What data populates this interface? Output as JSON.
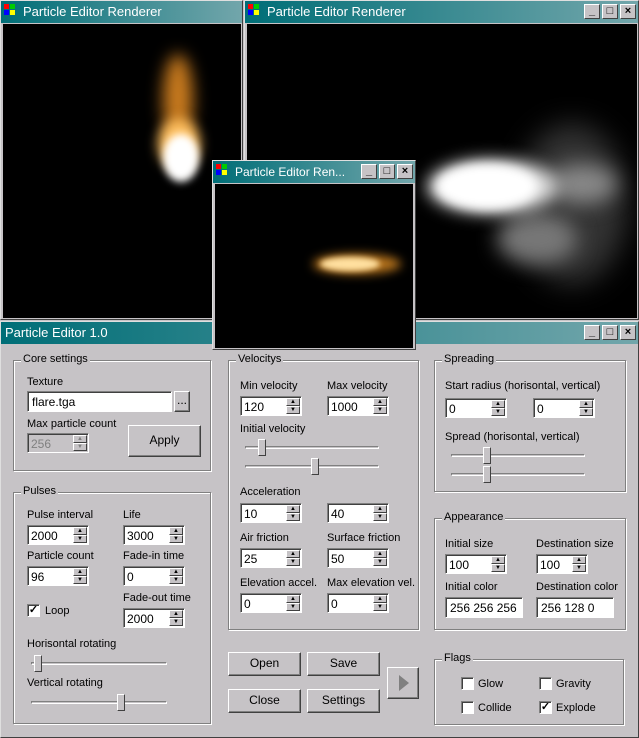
{
  "renderer": {
    "title": "Particle Editor Renderer",
    "title_small": "Particle Editor Ren..."
  },
  "editor": {
    "title": "Particle Editor 1.0"
  },
  "core": {
    "legend": "Core settings",
    "texture_label": "Texture",
    "texture_value": "flare.tga",
    "browse_label": "...",
    "max_count_label": "Max particle count",
    "max_count_value": "256",
    "apply_label": "Apply"
  },
  "pulses": {
    "legend": "Pulses",
    "pulse_interval_label": "Pulse interval",
    "pulse_interval_value": "2000",
    "life_label": "Life",
    "life_value": "3000",
    "particle_count_label": "Particle count",
    "particle_count_value": "96",
    "fade_in_label": "Fade-in time",
    "fade_in_value": "0",
    "fade_out_label": "Fade-out time",
    "fade_out_value": "2000",
    "loop_label": "Loop",
    "loop_checked": true,
    "hrot_label": "Horisontal rotating",
    "hrot_level": 0.02,
    "vrot_label": "Vertical rotating",
    "vrot_level": 0.67
  },
  "velocitys": {
    "legend": "Velocitys",
    "min_label": "Min velocity",
    "min_value": "120",
    "max_label": "Max velocity",
    "max_value": "1000",
    "initial_label": "Initial velocity",
    "initial_level_1": 0.1,
    "initial_level_2": 0.52,
    "accel_label": "Acceleration",
    "accel_value_1": "10",
    "accel_value_2": "40",
    "air_label": "Air friction",
    "air_value": "25",
    "surface_label": "Surface friction",
    "surface_value": "50",
    "elev_label": "Elevation accel.",
    "elev_value": "0",
    "max_elev_label": "Max elevation vel.",
    "max_elev_value": "0"
  },
  "spreading": {
    "legend": "Spreading",
    "radius_label": "Start radius (horisontal, vertical)",
    "radius_h": "0",
    "radius_v": "0",
    "spread_label": "Spread (horisontal, vertical)",
    "spread_level_1": 0.25,
    "spread_level_2": 0.25
  },
  "appearance": {
    "legend": "Appearance",
    "init_size_label": "Initial size",
    "init_size_value": "100",
    "dest_size_label": "Destination size",
    "dest_size_value": "100",
    "init_color_label": "Initial color",
    "init_color_value": "256 256 256",
    "dest_color_label": "Destination color",
    "dest_color_value": "256 128 0"
  },
  "buttons": {
    "open": "Open",
    "save": "Save",
    "close": "Close",
    "settings": "Settings"
  },
  "flags": {
    "legend": "Flags",
    "glow": "Glow",
    "glow_checked": false,
    "gravity": "Gravity",
    "gravity_checked": false,
    "collide": "Collide",
    "collide_checked": false,
    "explode": "Explode",
    "explode_checked": true
  },
  "colors": {
    "titlebar": "#006e77",
    "face": "#c6c3c6"
  },
  "icons": {
    "minimize": "minimize-icon",
    "maximize": "maximize-icon",
    "close": "close-icon",
    "play": "play-icon"
  }
}
